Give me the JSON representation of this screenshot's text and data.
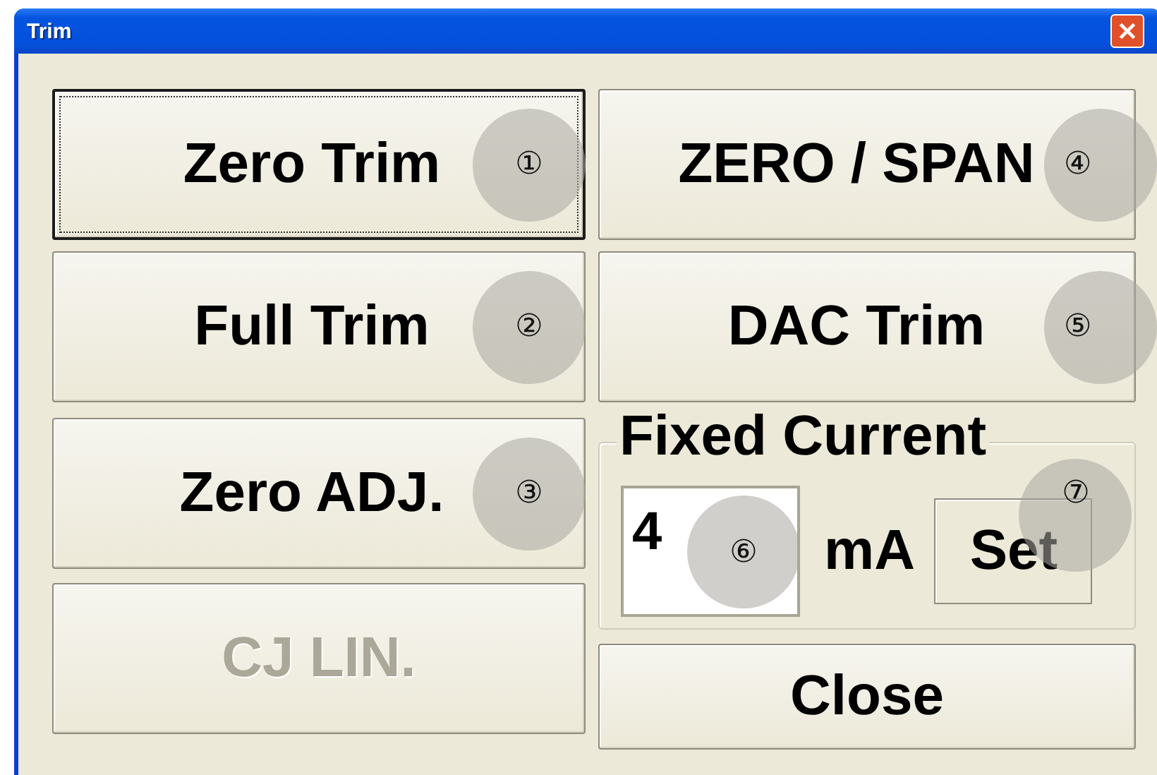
{
  "window": {
    "title": "Trim"
  },
  "left_buttons": [
    {
      "label": "Zero Trim",
      "callout": "①",
      "focused": true,
      "disabled": false
    },
    {
      "label": "Full Trim",
      "callout": "②",
      "focused": false,
      "disabled": false
    },
    {
      "label": "Zero ADJ.",
      "callout": "③",
      "focused": false,
      "disabled": false
    },
    {
      "label": "CJ LIN.",
      "focused": false,
      "disabled": true
    }
  ],
  "right_buttons": [
    {
      "label": "ZERO / SPAN",
      "callout": "④",
      "focused": false,
      "disabled": false
    },
    {
      "label": "DAC Trim",
      "callout": "⑤",
      "focused": false,
      "disabled": false
    }
  ],
  "fixed_current": {
    "legend": "Fixed Current",
    "input": {
      "value": "4",
      "callout": "⑥"
    },
    "unit": "mA",
    "set_button": {
      "label": "Set",
      "callout": "⑦"
    }
  },
  "close_button": {
    "label": "Close"
  }
}
